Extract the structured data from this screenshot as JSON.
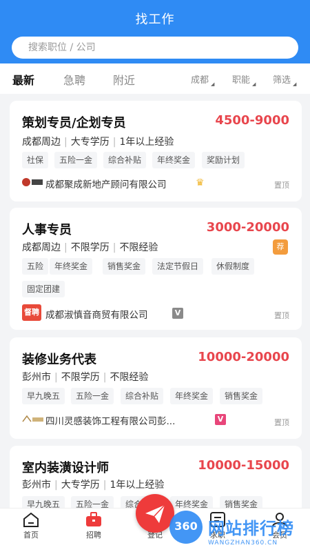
{
  "header": {
    "title": "找工作"
  },
  "search": {
    "placeholder": "搜索职位 / 公司"
  },
  "tabs": [
    {
      "label": "最新",
      "active": true
    },
    {
      "label": "急聘"
    },
    {
      "label": "附近"
    }
  ],
  "filters": [
    {
      "label": "成都"
    },
    {
      "label": "职能"
    },
    {
      "label": "筛选"
    }
  ],
  "jobs": [
    {
      "title": "策划专员/企划专员",
      "salary": "4500-9000",
      "location": "成都周边",
      "education": "大专学历",
      "experience": "1年以上经验",
      "tags": [
        "社保",
        "五险一金",
        "综合补贴",
        "年终奖金",
        "奖励计划"
      ],
      "company": "成都聚成新地产顾问有限公司",
      "pin": "置顶"
    },
    {
      "title": "人事专员",
      "salary": "3000-20000",
      "location": "成都周边",
      "education": "不限学历",
      "experience": "不限经验",
      "tags": [
        "五险",
        "年终奖金",
        "销售奖金",
        "法定节假日",
        "休假制度",
        "固定团建"
      ],
      "company": "成都淑慎音商贸有限公司",
      "pin": "置顶",
      "badge": "荐",
      "logo_text": "督聘"
    },
    {
      "title": "装修业务代表",
      "salary": "10000-20000",
      "location": "彭州市",
      "education": "不限学历",
      "experience": "不限经验",
      "tags": [
        "早九晚五",
        "五险一金",
        "综合补贴",
        "年终奖金",
        "销售奖金"
      ],
      "company": "四川灵感装饰工程有限公司彭...",
      "pin": "置顶"
    },
    {
      "title": "室内装潢设计师",
      "salary": "10000-15000",
      "location": "彭州市",
      "education": "大专学历",
      "experience": "1年以上经验",
      "tags": [
        "早九晚五",
        "五险一金",
        "综合补贴",
        "年终奖金",
        "销售奖金"
      ]
    }
  ],
  "tabbar": [
    {
      "label": "首页"
    },
    {
      "label": "招聘"
    },
    {
      "label": "登记"
    },
    {
      "label": "求职"
    },
    {
      "label": "会员"
    }
  ],
  "watermark": {
    "brand_num": "360",
    "brand_text": "网站排行榜",
    "url": "WANGZHAN360.CN"
  },
  "colors": {
    "primary": "#2f8bf4",
    "salary": "#e8464d",
    "fab": "#ee3b3b",
    "recommend": "#f39c3d"
  }
}
